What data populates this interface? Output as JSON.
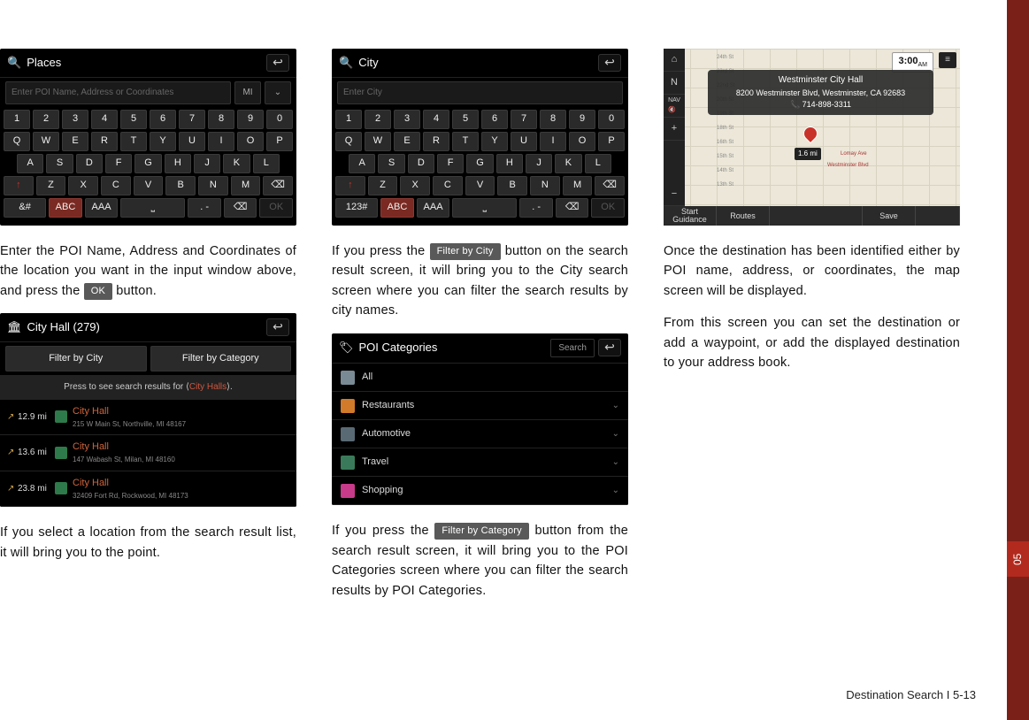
{
  "chapter_tab": "05",
  "footer": "Destination Search I 5-13",
  "col1": {
    "shot_places": {
      "title": "Places",
      "placeholder": "Enter POI Name, Address or Coordinates",
      "mi": "MI",
      "row1": [
        "1",
        "2",
        "3",
        "4",
        "5",
        "6",
        "7",
        "8",
        "9",
        "0"
      ],
      "row2": [
        "Q",
        "W",
        "E",
        "R",
        "T",
        "Y",
        "U",
        "I",
        "O",
        "P"
      ],
      "row3": [
        "A",
        "S",
        "D",
        "F",
        "G",
        "H",
        "J",
        "K",
        "L"
      ],
      "row4": [
        "↑",
        "Z",
        "X",
        "C",
        "V",
        "B",
        "N",
        "M",
        "⌫"
      ],
      "row5": [
        "&#",
        "ABC",
        "AAA",
        "␣",
        ". -",
        "⌫",
        "OK"
      ]
    },
    "para1_a": "Enter the POI Name, Address and Coordinates of the location you want in the input window above, and press the ",
    "para1_btn": "OK",
    "para1_b": " button.",
    "shot_results": {
      "title": "City Hall (279)",
      "filter_city": "Filter by City",
      "filter_cat": "Filter by Category",
      "hint_a": "Press to see search results for ⟨",
      "hint_hl": "City Halls",
      "hint_b": "⟩.",
      "rows": [
        {
          "dist": "12.9 mi",
          "name": "City Hall",
          "addr": "215 W Main St, Northville, MI 48167"
        },
        {
          "dist": "13.6 mi",
          "name": "City Hall",
          "addr": "147 Wabash St, Milan, MI 48160"
        },
        {
          "dist": "23.8 mi",
          "name": "City Hall",
          "addr": "32409 Fort Rd, Rockwood, MI 48173"
        }
      ]
    },
    "para2": "If you select a location from the search result list, it will bring you to the point."
  },
  "col2": {
    "shot_city": {
      "title": "City",
      "placeholder": "Enter City",
      "row1": [
        "1",
        "2",
        "3",
        "4",
        "5",
        "6",
        "7",
        "8",
        "9",
        "0"
      ],
      "row2": [
        "Q",
        "W",
        "E",
        "R",
        "T",
        "Y",
        "U",
        "I",
        "O",
        "P"
      ],
      "row3": [
        "A",
        "S",
        "D",
        "F",
        "G",
        "H",
        "J",
        "K",
        "L"
      ],
      "row4": [
        "↑",
        "Z",
        "X",
        "C",
        "V",
        "B",
        "N",
        "M",
        "⌫"
      ],
      "row5": [
        "123#",
        "ABC",
        "AAA",
        "␣",
        ". -",
        "⌫",
        "OK"
      ]
    },
    "para1_a": "If you press the ",
    "para1_btn": "Filter by City",
    "para1_b": " button on the search result screen, it will bring you to the City search screen where you can filter the search results by city names.",
    "shot_cats": {
      "title": "POI Categories",
      "search": "Search",
      "rows": [
        {
          "label": "All",
          "color": "#7a8a94",
          "expand": false
        },
        {
          "label": "Restaurants",
          "color": "#d07a2a",
          "expand": true
        },
        {
          "label": "Automotive",
          "color": "#5a6a74",
          "expand": true
        },
        {
          "label": "Travel",
          "color": "#3a7a5a",
          "expand": true
        },
        {
          "label": "Shopping",
          "color": "#c83a8a",
          "expand": true
        }
      ]
    },
    "para2_a": "If you press the ",
    "para2_btn": "Filter by Category",
    "para2_b": " button from the search result screen, it will bring you to the POI Categories screen where you can filter the search results by POI Categories."
  },
  "col3": {
    "map": {
      "clock": "3:00",
      "clock_ampm": "AM",
      "popup_title": "Westminster City Hall",
      "popup_addr": "8200 Westminster Blvd, Westminster, CA 92683",
      "popup_phone": "📞 714-898-3311",
      "dist": "1.6 mi",
      "btn_start": "Start\nGuidance",
      "btn_routes": "Routes",
      "btn_save": "Save",
      "streets_h": [
        "24th St",
        "23rd St",
        "22nd St",
        "20th St",
        "19th St",
        "18th St",
        "16th St",
        "15th St",
        "14th St",
        "13th St"
      ],
      "streets_v": [
        "Lomay Ave",
        "Westminster Blvd"
      ]
    },
    "para1": "Once the destination has been identified either by POI name, address, or coordinates, the map screen will be displayed.",
    "para2": "From this screen you can set the destination or add a waypoint, or add the displayed destination to your address book."
  }
}
